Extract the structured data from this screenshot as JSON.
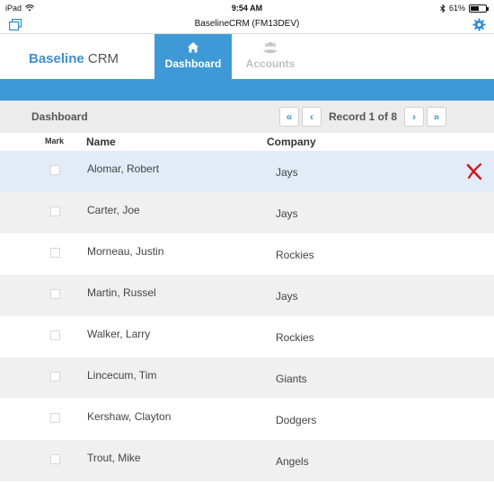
{
  "status_bar": {
    "device": "iPad",
    "time": "9:54 AM",
    "battery": "61%",
    "battery_level": 0.61
  },
  "app": {
    "title": "BaselineCRM (FM13DEV)"
  },
  "brand": {
    "part1": "Baseline",
    "part2": " CRM"
  },
  "tabs": [
    {
      "label": "Dashboard",
      "icon": "home-icon",
      "active": true
    },
    {
      "label": "Accounts",
      "icon": "people-icon",
      "active": false
    }
  ],
  "toolbar": {
    "title": "Dashboard",
    "first_icon": "«",
    "prev_icon": "‹",
    "record_text": "Record 1 of 8",
    "next_icon": "›",
    "last_icon": "»"
  },
  "columns": {
    "mark": "Mark",
    "name": "Name",
    "company": "Company"
  },
  "rows": [
    {
      "name": "Alomar, Robert",
      "company": "Jays"
    },
    {
      "name": "Carter, Joe",
      "company": "Jays"
    },
    {
      "name": "Morneau, Justin",
      "company": "Rockies"
    },
    {
      "name": "Martin, Russel",
      "company": "Jays"
    },
    {
      "name": "Walker, Larry",
      "company": "Rockies"
    },
    {
      "name": "Lincecum, Tim",
      "company": "Giants"
    },
    {
      "name": "Kershaw, Clayton",
      "company": "Dodgers"
    },
    {
      "name": "Trout, Mike",
      "company": "Angels"
    }
  ],
  "colors": {
    "accent": "#3f99d6",
    "selected_row": "#e1ecf7",
    "alt_row": "#f0f0f0",
    "delete": "#d0171b"
  }
}
